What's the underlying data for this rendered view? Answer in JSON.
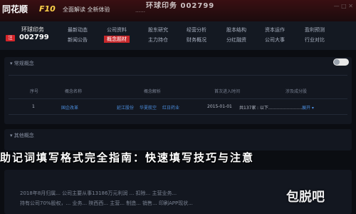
{
  "topbar": {
    "logo": "同花顺",
    "app": "F10",
    "menu": "全面解读 全新体验",
    "ticker": "环球印务 002799",
    "subticker": "……"
  },
  "security": {
    "code_label": "环球印务",
    "badge": "注",
    "number": "002799"
  },
  "nav": [
    "最新动态",
    "公司资料",
    "股东研究",
    "经营分析",
    "股本结构",
    "资本运作",
    "盈利预测",
    "新闻公告",
    "概念题材",
    "主力持仓",
    "财务概况",
    "分红融资",
    "公司大事",
    "行业对比"
  ],
  "panel1": {
    "heading": "常规概念",
    "columns": [
      "序号",
      "概念名称",
      "概念解析",
      "首次进入时间",
      "涉及成分股"
    ],
    "rows": [
      {
        "index": "1",
        "name": "国企改革",
        "tags": [
          "延江股份",
          "华夏航空",
          "红日药业"
        ],
        "date": "2015-01-01",
        "count_label": "共137家",
        "more": "展开"
      }
    ]
  },
  "panel2": {
    "heading": "其他概念"
  },
  "headline": "助记词填写格式完全指南：快速填写技巧与注意",
  "blurred": [
    "2018年8月归属... 公司主要从事13186万元利润 ... 扣除... 主营业务...",
    "持有公司70%股权，... 业务... 陕西西... 主营... 制造... 销售... 印刷APP现状..."
  ],
  "watermark": "包脱吧"
}
